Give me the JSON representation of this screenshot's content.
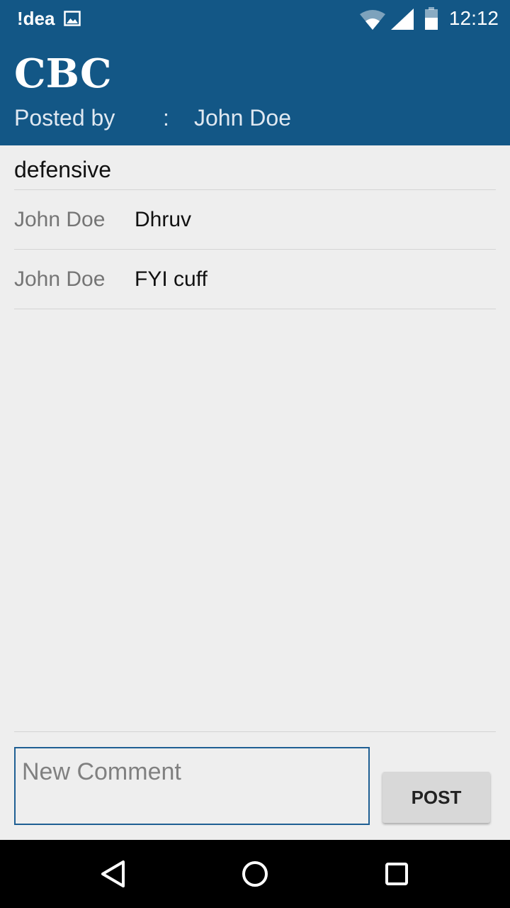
{
  "status_bar": {
    "carrier": "!dea",
    "time": "12:12",
    "icons": [
      "gallery-icon",
      "wifi-icon",
      "signal-icon",
      "battery-icon"
    ]
  },
  "app_bar": {
    "title": "CBC",
    "posted_by_label": "Posted by",
    "separator": ":",
    "author": "John Doe"
  },
  "post": {
    "body": "defensive"
  },
  "comments": [
    {
      "author": "John Doe",
      "text": "Dhruv"
    },
    {
      "author": "John Doe",
      "text": "FYI cuff"
    }
  ],
  "composer": {
    "placeholder": "New Comment",
    "value": "",
    "button_label": "POST"
  },
  "nav_bar": {
    "icons": [
      "back-icon",
      "home-icon",
      "recents-icon"
    ]
  },
  "colors": {
    "primary": "#135786",
    "background": "#eeeeee",
    "input_border": "#1f5f93",
    "button": "#d8d8d8"
  }
}
